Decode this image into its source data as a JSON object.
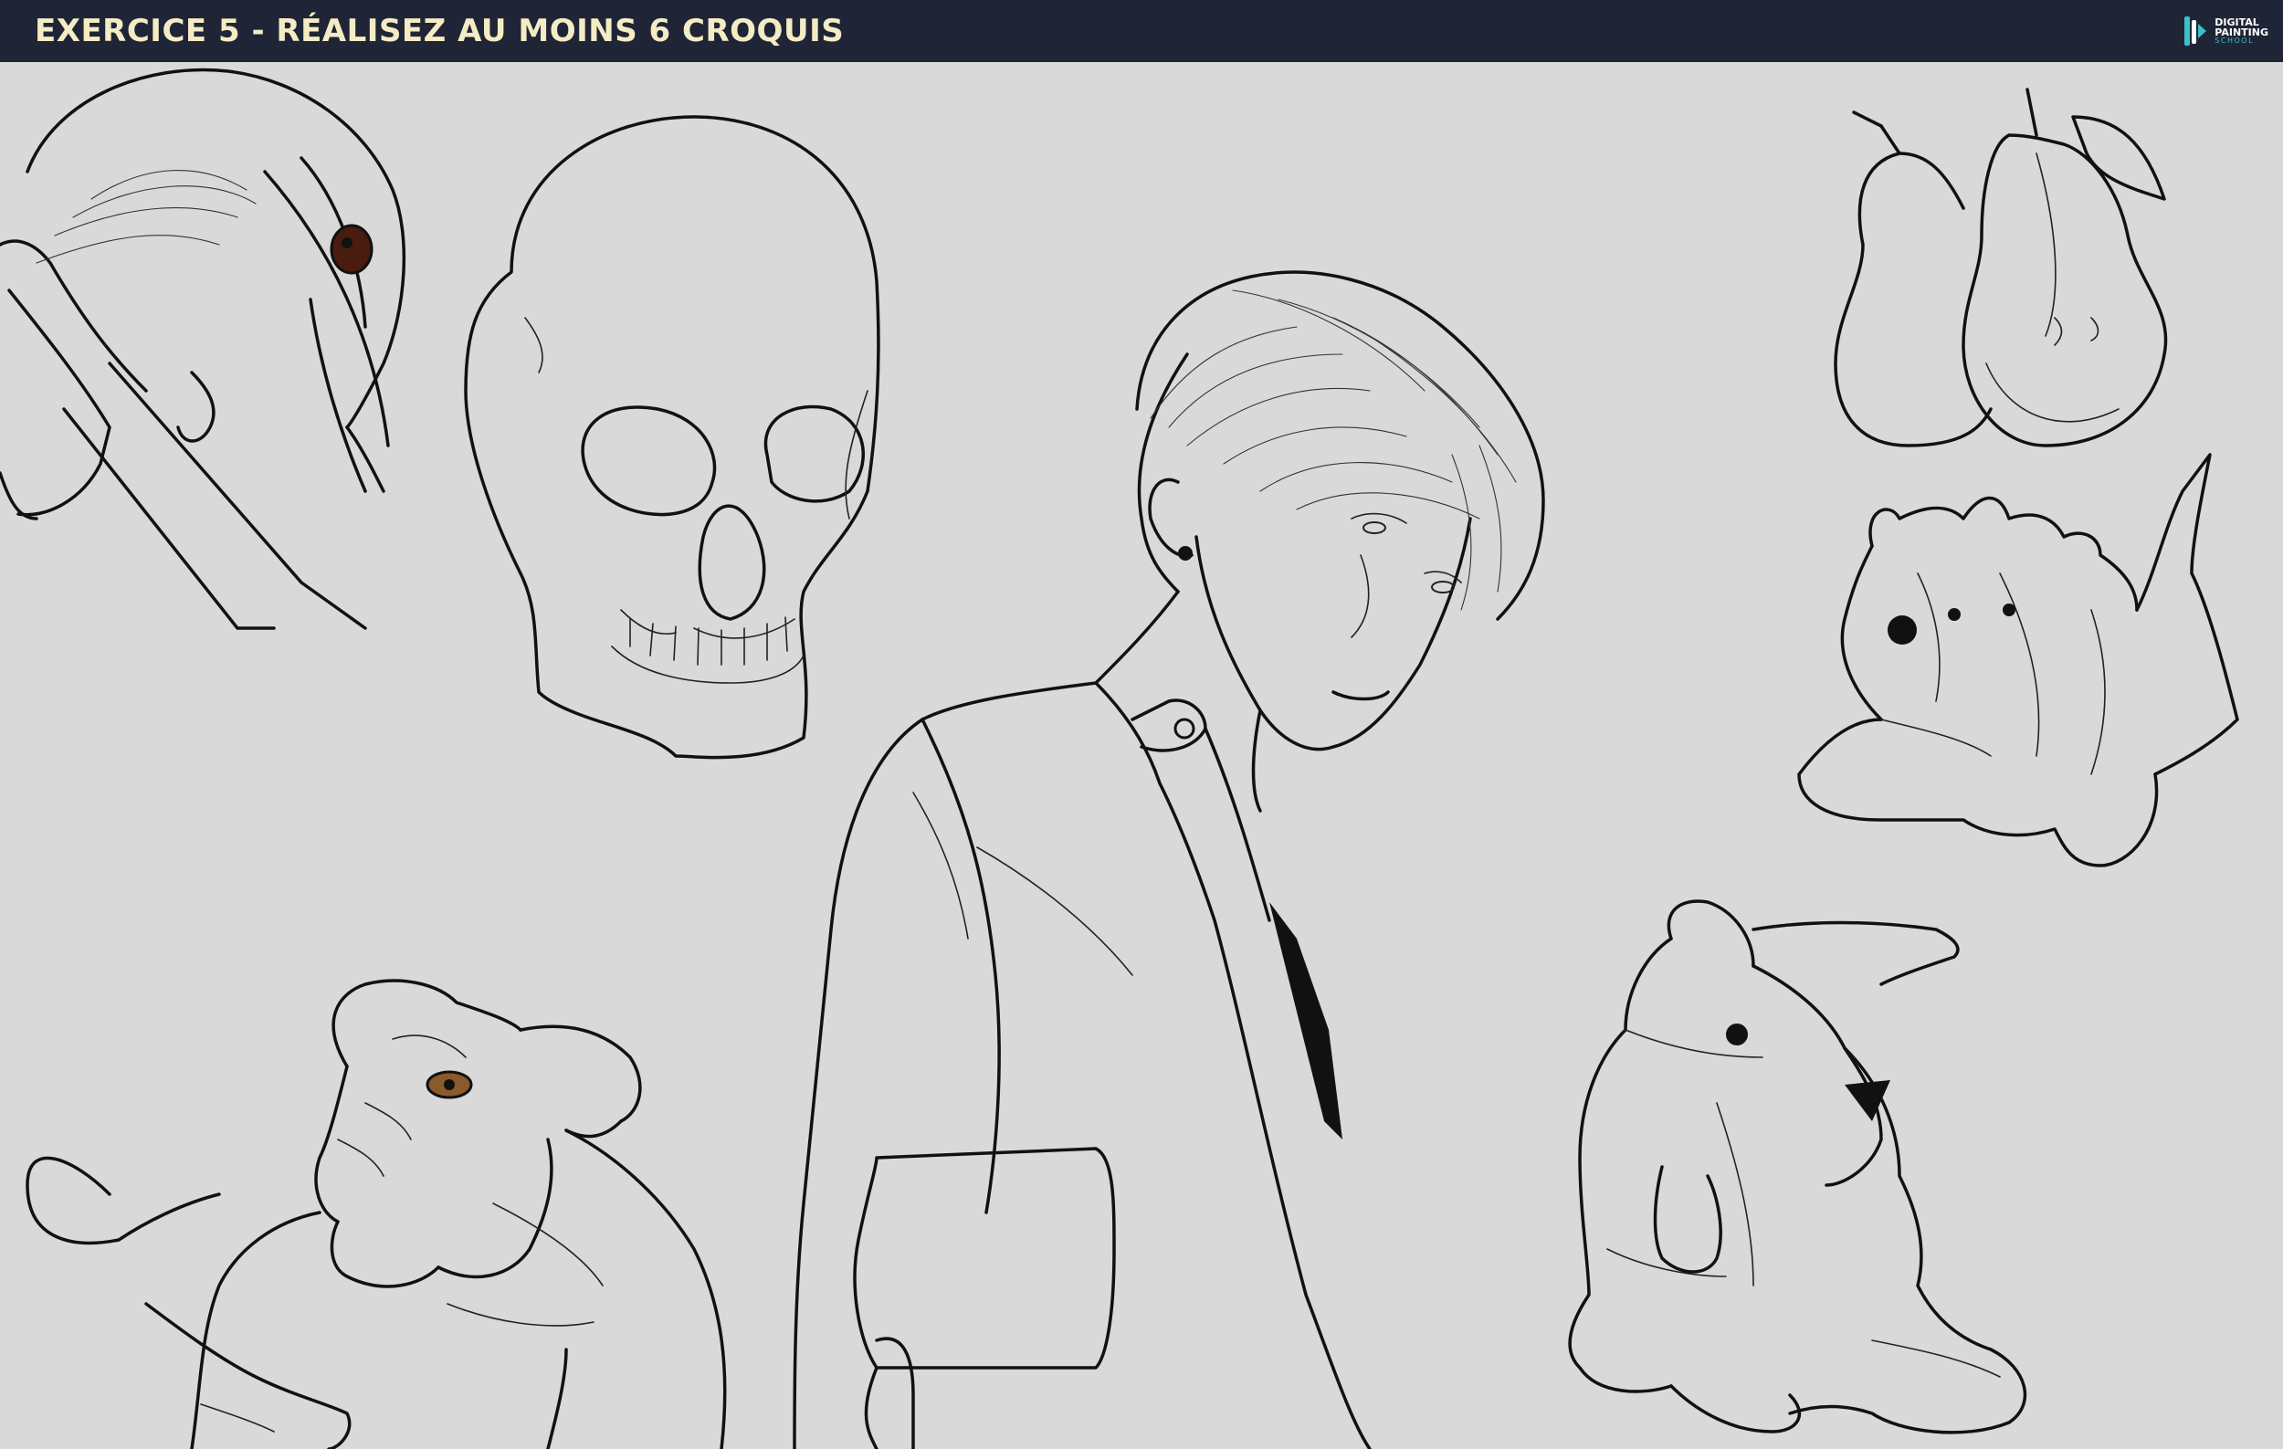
{
  "header": {
    "title": "EXERCICE 5 - RÉALISEZ AU MOINS 6 CROQUIS",
    "logo": {
      "line1": "DIGITAL",
      "line2": "PAINTING",
      "line3": "SCHOOL",
      "icon": "brush-logo-icon"
    }
  },
  "colors": {
    "header_bg": "#1f2536",
    "title": "#f4ecc4",
    "canvas_bg": "#d9d9d9",
    "ink": "#111111",
    "accent": "#38c3c8"
  },
  "sketches": [
    {
      "id": "toucan",
      "icon": "toucan-sketch"
    },
    {
      "id": "skull",
      "icon": "skull-sketch"
    },
    {
      "id": "boy",
      "icon": "portrait-sketch"
    },
    {
      "id": "pears",
      "icon": "pears-sketch"
    },
    {
      "id": "plush-dino",
      "icon": "plush-dino-sketch"
    },
    {
      "id": "bulldog",
      "icon": "bulldog-sketch"
    },
    {
      "id": "plush-bunny",
      "icon": "plush-bunny-sketch"
    }
  ]
}
